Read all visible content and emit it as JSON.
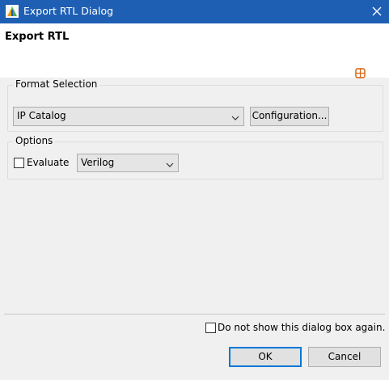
{
  "window": {
    "title": "Export RTL Dialog"
  },
  "header": {
    "title": "Export RTL"
  },
  "format_selection": {
    "label": "Format Selection",
    "format_value": "IP Catalog",
    "configuration_button": "Configuration..."
  },
  "options": {
    "label": "Options",
    "evaluate_label": "Evaluate",
    "evaluate_checked": false,
    "language_value": "Verilog"
  },
  "footer": {
    "dont_show_label": "Do not show this dialog box again.",
    "ok_label": "OK",
    "cancel_label": "Cancel"
  },
  "colors": {
    "titlebar": "#1e5fb4",
    "accent": "#0078d7"
  }
}
